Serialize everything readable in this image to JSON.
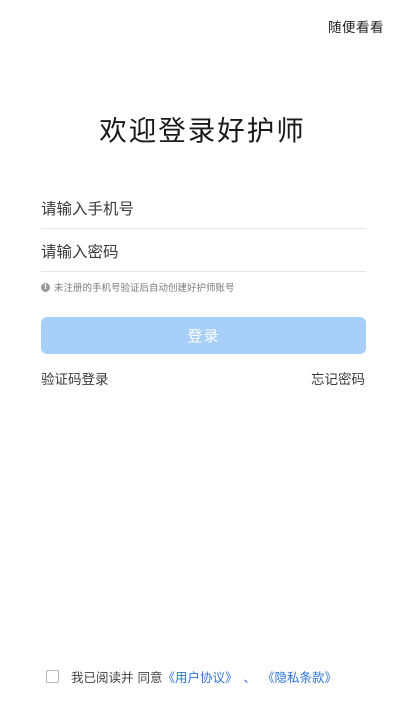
{
  "header": {
    "browse_label": "随便看看"
  },
  "title": "欢迎登录好护师",
  "form": {
    "phone_placeholder": "请输入手机号",
    "password_placeholder": "请输入密码",
    "hint_icon": "!",
    "hint_text": "未注册的手机号验证后自动创建好护师账号",
    "login_label": "登录"
  },
  "links": {
    "sms_login": "验证码登录",
    "forgot_password": "忘记密码"
  },
  "agreement": {
    "prefix": "我已阅读并 同意",
    "user_agreement": "《用户协议》",
    "separator": "、",
    "privacy_policy": "《隐私条款》",
    "checked": false
  },
  "colors": {
    "accent": "#2e74d6",
    "login_button": "#a7cff7"
  }
}
